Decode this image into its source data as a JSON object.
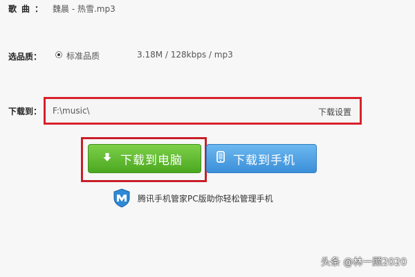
{
  "song": {
    "label": "歌曲：",
    "value": "魏晨 - 热雪.mp3"
  },
  "quality": {
    "label": "选品质：",
    "option_label": "标准品质",
    "info": "3.18M / 128kbps / mp3",
    "selected": true
  },
  "download_path": {
    "label": "下载到：",
    "path": "F:\\music\\",
    "settings_link": "下载设置"
  },
  "buttons": {
    "download_pc": "下载到电脑",
    "download_phone": "下载到手机"
  },
  "tip": {
    "text": "腾讯手机管家PC版助你轻松管理手机"
  },
  "watermark": {
    "text": "头条 @林一顾2020"
  },
  "colors": {
    "highlight": "#c81e28",
    "pc_button": "#5cb82c",
    "phone_button": "#4a9ce0"
  }
}
